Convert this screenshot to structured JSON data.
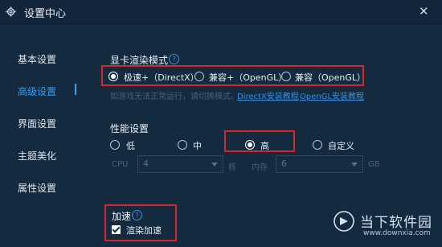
{
  "window": {
    "title": "设置中心"
  },
  "sidebar": {
    "items": [
      {
        "label": "基本设置"
      },
      {
        "label": "高级设置"
      },
      {
        "label": "界面设置"
      },
      {
        "label": "主题美化"
      },
      {
        "label": "属性设置"
      }
    ]
  },
  "graphics": {
    "title": "显卡渲染模式",
    "options": [
      {
        "label": "极速+（DirectX）",
        "selected": true
      },
      {
        "label": "兼容+（OpenGL）",
        "selected": false
      },
      {
        "label": "兼容（OpenGL）",
        "selected": false
      }
    ],
    "hint": "如游戏无法正常运行，请切换模式。",
    "links": [
      "DirectX安装教程",
      "OpenGL安装教程"
    ]
  },
  "performance": {
    "title": "性能设置",
    "options": [
      {
        "label": "低",
        "selected": false
      },
      {
        "label": "中",
        "selected": false
      },
      {
        "label": "高",
        "selected": true
      },
      {
        "label": "自定义",
        "selected": false
      }
    ],
    "cpu": {
      "label": "CPU",
      "value": "4",
      "unit": "核"
    },
    "memory": {
      "label": "内存",
      "value": "6",
      "unit": "GB"
    }
  },
  "acceleration": {
    "title": "加速",
    "checkbox_label": "渲染加速",
    "checked": true
  },
  "watermark": {
    "text_cn": "当下软件园",
    "text_en": "www.downxia.com"
  },
  "colors": {
    "background": "#142a3f",
    "accent": "#3a9df5",
    "highlight_box": "#d6262e"
  }
}
